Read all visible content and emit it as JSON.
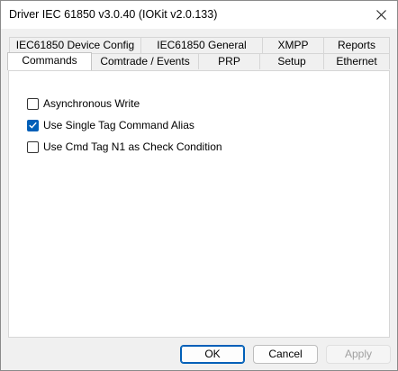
{
  "window": {
    "title": "Driver IEC 61850 v3.0.40 (IOKit v2.0.133)"
  },
  "tabs_row_back": [
    {
      "label": "IEC61850 Device Config"
    },
    {
      "label": "IEC61850 General"
    },
    {
      "label": "XMPP"
    },
    {
      "label": "Reports"
    }
  ],
  "tabs_row_front": [
    {
      "label": "Commands",
      "active": true
    },
    {
      "label": "Comtrade / Events"
    },
    {
      "label": "PRP"
    },
    {
      "label": "Setup"
    },
    {
      "label": "Ethernet"
    }
  ],
  "options": [
    {
      "label": "Asynchronous Write",
      "checked": false
    },
    {
      "label": "Use Single Tag Command Alias",
      "checked": true
    },
    {
      "label": "Use Cmd Tag N1 as Check Condition",
      "checked": false
    }
  ],
  "buttons": {
    "ok": "OK",
    "cancel": "Cancel",
    "apply": "Apply"
  },
  "colors": {
    "accent": "#005fb8",
    "disabled_text": "#a0a0a0"
  }
}
